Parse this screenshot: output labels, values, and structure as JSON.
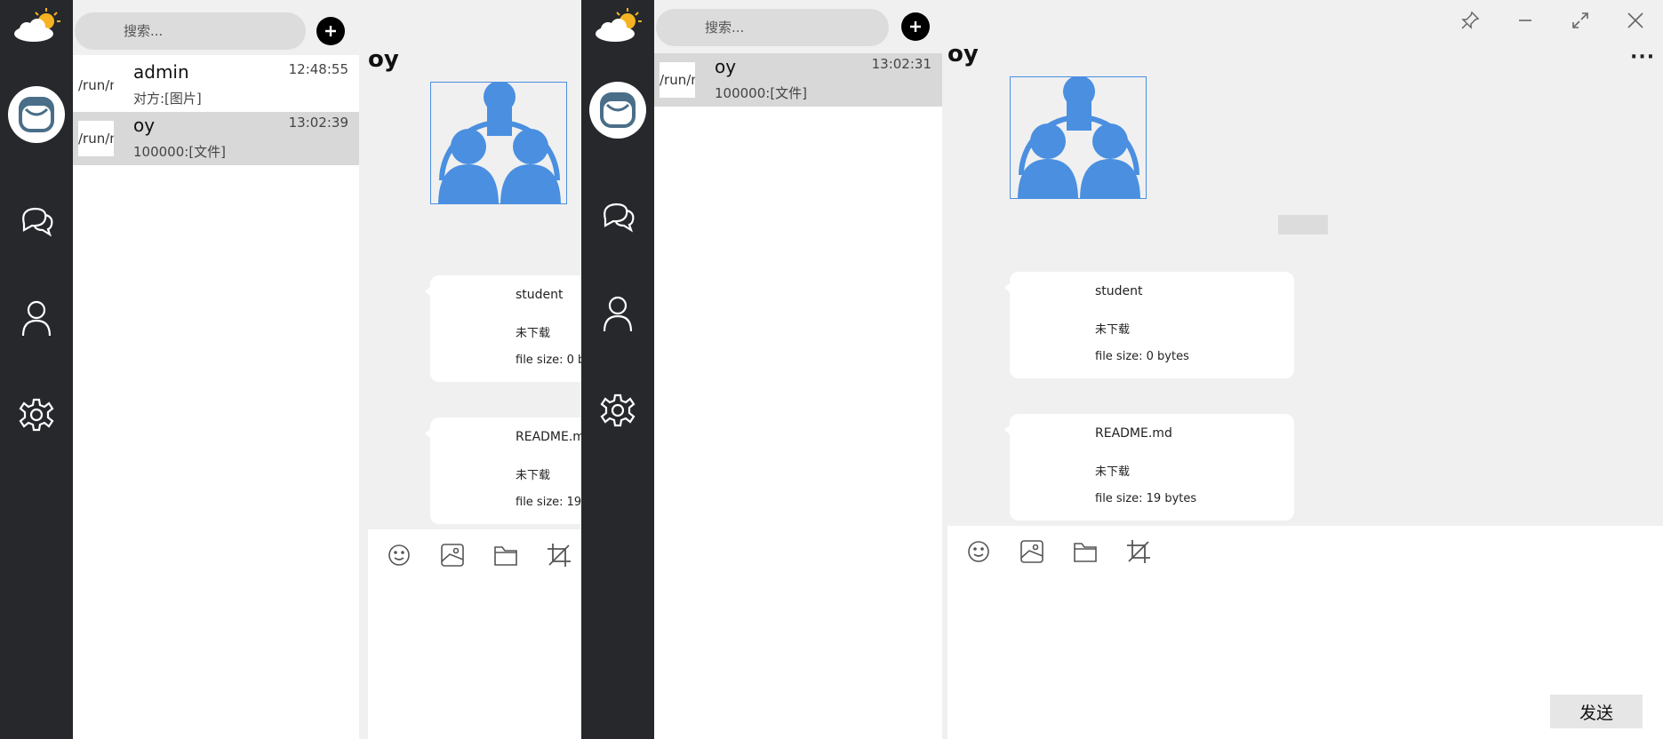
{
  "search": {
    "placeholder": "搜索..."
  },
  "chats": [
    {
      "thumb_text": "/run/media",
      "name": "admin",
      "time": "12:48:55",
      "last": "对方:[图片]"
    },
    {
      "thumb_text": "/run/media",
      "name": "oy",
      "time": "13:02:39",
      "last": "100000:[文件]"
    }
  ],
  "chats_b": [
    {
      "thumb_text": "/run/media",
      "name": "oy",
      "time": "13:02:31",
      "last": "100000:[文件]"
    }
  ],
  "conversation": {
    "title": "oy",
    "files": [
      {
        "name": "student",
        "status": "未下载",
        "size": "file size: 0 bytes"
      },
      {
        "name": "README.md",
        "status": "未下载",
        "size": "file size: 19 bytes"
      }
    ]
  },
  "composer": {
    "send_label": "发送"
  },
  "icons": {
    "logo": "weather-logo-icon",
    "avatar": "mailbox-icon",
    "messages": "chat-bubbles-icon",
    "contacts": "user-icon",
    "settings": "gear-icon",
    "emoji": "emoji-icon",
    "image": "image-icon",
    "file": "folder-icon",
    "screenshot": "crop-icon"
  },
  "colors": {
    "sidebar": "#26282c",
    "selected_row": "#d8d8d8",
    "avatar_blue": "#4a8fe0",
    "background": "#f0f0f0"
  }
}
